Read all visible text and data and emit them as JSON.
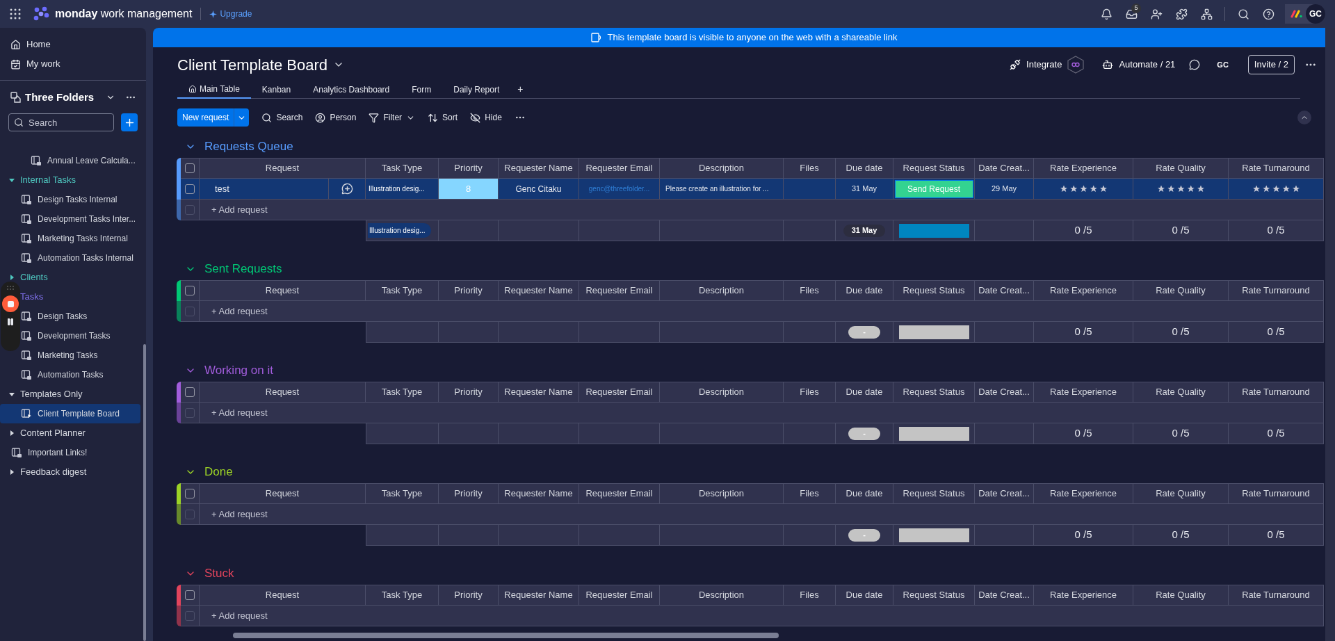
{
  "top_bar": {
    "logo_bold": "monday",
    "logo_rest": "work management",
    "upgrade": "Upgrade",
    "inbox_badge": "5",
    "avatar": "GC"
  },
  "sidebar": {
    "nav": [
      {
        "label": "Home"
      },
      {
        "label": "My work"
      }
    ],
    "workspace": "Three Folders",
    "search": {
      "placeholder": "Search"
    },
    "scrolled_children": [
      {
        "kind": "board",
        "label": "Annual Leave Calcula...",
        "selected": false
      }
    ],
    "tree": [
      {
        "kind": "folder",
        "label": "Internal Tasks",
        "color": "#4fc8c0",
        "expanded": true,
        "children": [
          {
            "kind": "board",
            "label": "Design Tasks Internal",
            "selected": false
          },
          {
            "kind": "board",
            "label": "Development Tasks Inter...",
            "selected": false
          },
          {
            "kind": "board",
            "label": "Marketing Tasks Internal",
            "selected": false
          },
          {
            "kind": "board",
            "label": "Automation Tasks Internal",
            "selected": false
          }
        ]
      },
      {
        "kind": "folder",
        "label": "Clients",
        "color": "#4fc8c0",
        "expanded": false
      },
      {
        "kind": "folder",
        "label": "Tasks",
        "color": "#7e6fe8",
        "expanded": true,
        "children": [
          {
            "kind": "board",
            "label": "Design Tasks",
            "selected": false
          },
          {
            "kind": "board",
            "label": "Development Tasks",
            "selected": false
          },
          {
            "kind": "board",
            "label": "Marketing Tasks",
            "selected": false
          },
          {
            "kind": "board",
            "label": "Automation Tasks",
            "selected": false
          }
        ]
      },
      {
        "kind": "folder",
        "label": "Templates Only",
        "color": "#d5d8df",
        "expanded": true,
        "children": [
          {
            "kind": "board",
            "label": "Client Template Board",
            "selected": true
          }
        ]
      },
      {
        "kind": "folder",
        "label": "Content Planner",
        "color": "#d5d8df",
        "expanded": false
      },
      {
        "kind": "board",
        "label": "Important Links!",
        "selected": false
      },
      {
        "kind": "folder",
        "label": "Feedback digest",
        "color": "#d5d8df",
        "expanded": false
      }
    ]
  },
  "banner": "This template board is visible to anyone on the web with a shareable link",
  "board": {
    "title": "Client Template Board",
    "integrate": "Integrate",
    "automate": "Automate / 21",
    "avatar": "GC",
    "invite": "Invite / 2",
    "tabs": [
      {
        "label": "Main Table",
        "selected": true
      },
      {
        "label": "Kanban",
        "selected": false
      },
      {
        "label": "Analytics Dashboard",
        "selected": false
      },
      {
        "label": "Form",
        "selected": false
      },
      {
        "label": "Daily Report",
        "selected": false
      }
    ],
    "add_tab": "+",
    "new_item": "New request",
    "toolbar": [
      {
        "label": "Search"
      },
      {
        "label": "Person"
      },
      {
        "label": "Filter"
      },
      {
        "label": "Sort"
      },
      {
        "label": "Hide"
      }
    ]
  },
  "groups": [
    {
      "name": "Requests Queue",
      "color": "#579bfc",
      "select_all": {
        "checked": false
      },
      "columns": [
        "Request",
        "Task Type",
        "Priority",
        "Requester Name",
        "Requester Email",
        "Description",
        "Files",
        "Due date",
        "Request Status",
        "Date Creat...",
        "Rate Experience",
        "Rate Quality",
        "Rate Turnaround"
      ],
      "rows": [
        {
          "name": "test",
          "selected": true,
          "checked": false,
          "task_type": "Illustration desig...",
          "priority": {
            "label": "8",
            "color": "#85d6ff"
          },
          "requester": "Genc Citaku",
          "email": "genc@threefolder...",
          "description": "Please create an illustration for ...",
          "due": "31 May",
          "status": {
            "label": "Send Request",
            "color": "#33d391"
          },
          "created": "29 May"
        }
      ],
      "add": {
        "label": "+ Add request",
        "checked": false
      },
      "summary": {
        "task_type": "Illustration desig...",
        "due": {
          "label": "31 May",
          "color": "#2c2d3f"
        },
        "status_bar": {
          "color": "#0086c0"
        },
        "ratings": [
          "0 /5",
          "0 /5",
          "0 /5"
        ]
      }
    },
    {
      "name": "Sent Requests",
      "color": "#00c875",
      "select_all": {
        "checked": false
      },
      "columns": [
        "Request",
        "Task Type",
        "Priority",
        "Requester Name",
        "Requester Email",
        "Description",
        "Files",
        "Due date",
        "Request Status",
        "Date Creat...",
        "Rate Experience",
        "Rate Quality",
        "Rate Turnaround"
      ],
      "add": {
        "label": "+ Add request",
        "checked": false
      },
      "summary": {
        "due": {
          "label": "-",
          "color": "#c4c4c4"
        },
        "status_bar": {
          "color": "#c4c4c4"
        },
        "ratings": [
          "0 /5",
          "0 /5",
          "0 /5"
        ]
      }
    },
    {
      "name": "Working on it",
      "color": "#a25ddc",
      "select_all": {
        "checked": false
      },
      "columns": [
        "Request",
        "Task Type",
        "Priority",
        "Requester Name",
        "Requester Email",
        "Description",
        "Files",
        "Due date",
        "Request Status",
        "Date Creat...",
        "Rate Experience",
        "Rate Quality",
        "Rate Turnaround"
      ],
      "add": {
        "label": "+ Add request",
        "checked": false
      },
      "summary": {
        "due": {
          "label": "-",
          "color": "#c4c4c4"
        },
        "status_bar": {
          "color": "#c4c4c4"
        },
        "ratings": [
          "0 /5",
          "0 /5",
          "0 /5"
        ]
      }
    },
    {
      "name": "Done",
      "color": "#9cd326",
      "select_all": {
        "checked": false
      },
      "columns": [
        "Request",
        "Task Type",
        "Priority",
        "Requester Name",
        "Requester Email",
        "Description",
        "Files",
        "Due date",
        "Request Status",
        "Date Creat...",
        "Rate Experience",
        "Rate Quality",
        "Rate Turnaround"
      ],
      "add": {
        "label": "+ Add request",
        "checked": false
      },
      "summary": {
        "due": {
          "label": "-",
          "color": "#c4c4c4"
        },
        "status_bar": {
          "color": "#c4c4c4"
        },
        "ratings": [
          "0 /5",
          "0 /5",
          "0 /5"
        ]
      }
    },
    {
      "name": "Stuck",
      "color": "#e2445c",
      "select_all": {
        "checked": false
      },
      "columns": [
        "Request",
        "Task Type",
        "Priority",
        "Requester Name",
        "Requester Email",
        "Description",
        "Files",
        "Due date",
        "Request Status",
        "Date Creat...",
        "Rate Experience",
        "Rate Quality",
        "Rate Turnaround"
      ],
      "add": {
        "label": "+ Add request",
        "checked": false
      }
    }
  ]
}
